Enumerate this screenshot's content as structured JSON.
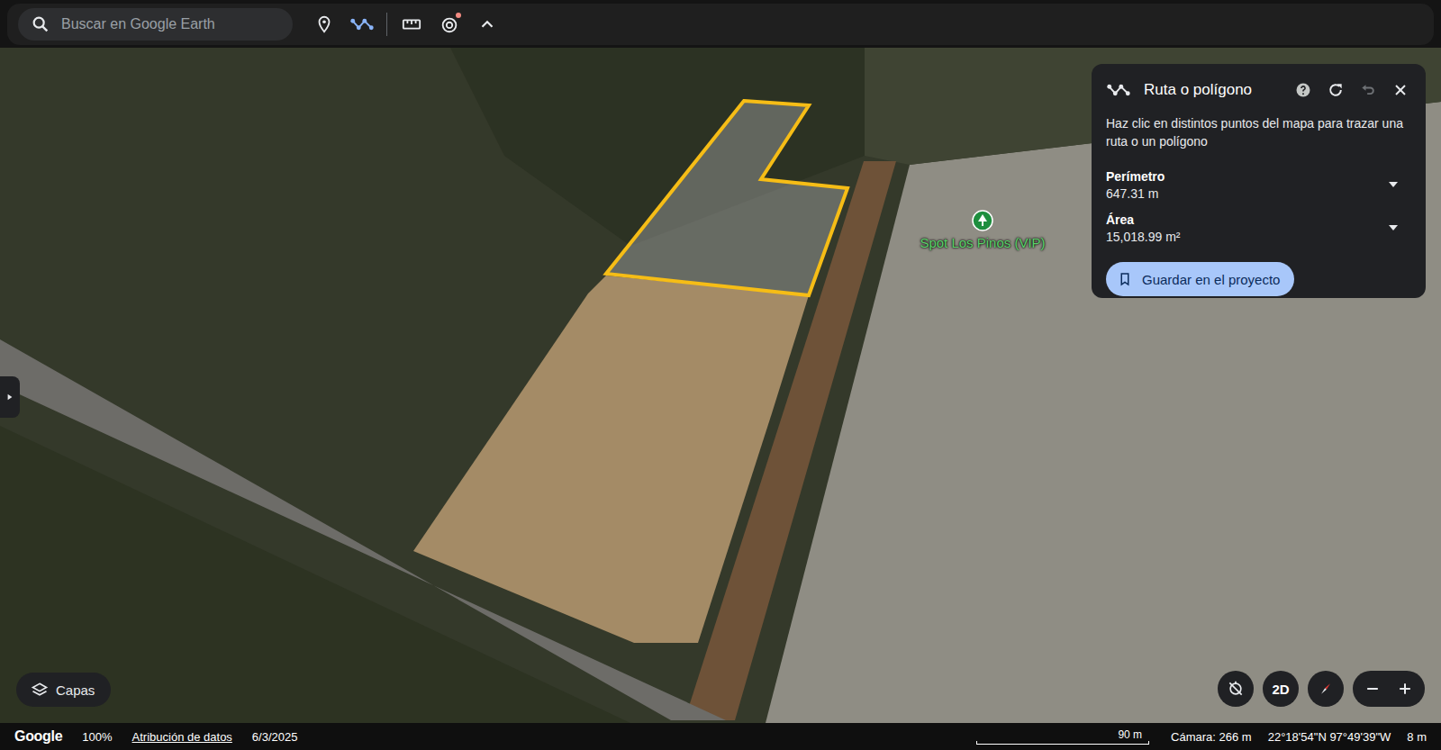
{
  "toolbar": {
    "search_placeholder": "Buscar en Google Earth",
    "tools": [
      {
        "kind": "placemark",
        "badge": false
      },
      {
        "kind": "route",
        "badge": false
      },
      {
        "kind": "divider",
        "badge": false
      },
      {
        "kind": "ruler",
        "badge": false
      },
      {
        "kind": "voyager",
        "badge": true
      },
      {
        "kind": "collapse",
        "badge": false
      }
    ]
  },
  "panel": {
    "title": "Ruta o polígono",
    "actions": [
      {
        "kind": "help",
        "disabled": false
      },
      {
        "kind": "refresh",
        "disabled": false
      },
      {
        "kind": "undo",
        "disabled": true
      },
      {
        "kind": "close",
        "disabled": false
      }
    ],
    "instructions": "Haz clic en distintos puntos del mapa para trazar una ruta o un polígono",
    "measures": [
      {
        "label": "Perímetro",
        "value": "647.31 m",
        "expanded": false
      },
      {
        "label": "Área",
        "value": "15,018.99 m²",
        "expanded": false
      }
    ],
    "button": "Guardar en el proyecto"
  },
  "map": {
    "places": [
      {
        "label": "Spot Los Pinos (VIP)"
      }
    ],
    "layers_button": "Capas",
    "view_button": "2D"
  },
  "status_bar": {
    "logo": "Google",
    "zoom": "100%",
    "attribution": "Atribución de datos",
    "date": "6/3/2025",
    "scale": "90 m",
    "camera": "Cámara: 266 m",
    "coordinates": "22°18'54\"N 97°49'39\"W",
    "altitude": "8 m"
  }
}
